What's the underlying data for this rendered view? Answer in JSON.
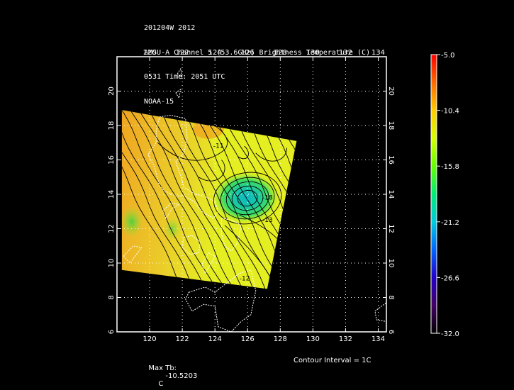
{
  "header": {
    "line1": "201204W 2012",
    "line2": "AMSU-A Channel 5 (53.6GHz) Brightness Temperature (C)",
    "line3": "0531 Time: 2051 UTC",
    "line4": "NOAA-15"
  },
  "map": {
    "lon_range": [
      118,
      134.5
    ],
    "lat_range": [
      6,
      22
    ],
    "lon_ticks": [
      120,
      122,
      124,
      126,
      128,
      130,
      132,
      134
    ],
    "lat_ticks": [
      6,
      8,
      10,
      12,
      14,
      16,
      18,
      20
    ],
    "grid": "dotted",
    "swath_corners_lonlat": [
      [
        118.3,
        18.9
      ],
      [
        129.0,
        17.1
      ],
      [
        127.2,
        8.5
      ],
      [
        118.3,
        9.6
      ]
    ],
    "storm_center_lonlat": [
      125.9,
      13.8
    ],
    "contour_labels": [
      {
        "text": "-18",
        "lon": 126.9,
        "lat": 13.7
      },
      {
        "text": "-13",
        "lon": 126.9,
        "lat": 12.4
      },
      {
        "text": "-12",
        "lon": 125.5,
        "lat": 9.0
      },
      {
        "text": "-11",
        "lon": 123.9,
        "lat": 16.7
      },
      {
        "text": "-11",
        "lon": 128.6,
        "lat": 10.8
      }
    ]
  },
  "colorbar": {
    "ticks": [
      "-5.0",
      "-10.4",
      "-15.8",
      "-21.2",
      "-26.6",
      "-32.0"
    ],
    "colors": [
      "#ff0000",
      "#ff6a00",
      "#ffcc00",
      "#d8ff00",
      "#66ff00",
      "#00ee77",
      "#00ccdd",
      "#0066ff",
      "#2200cc",
      "#440066",
      "#000000"
    ]
  },
  "footer": {
    "max_tb_label": "Max Tb:",
    "max_tb_value": "-10.5203",
    "max_tb_unit": "C",
    "contour_interval": "Contour Interval = 1C"
  },
  "colors": {
    "background": "#000000",
    "swath_base": "#e4ee20",
    "warm_band": "#f0a020",
    "cool_core": "#18c6a8",
    "coast": "#ffffff"
  }
}
